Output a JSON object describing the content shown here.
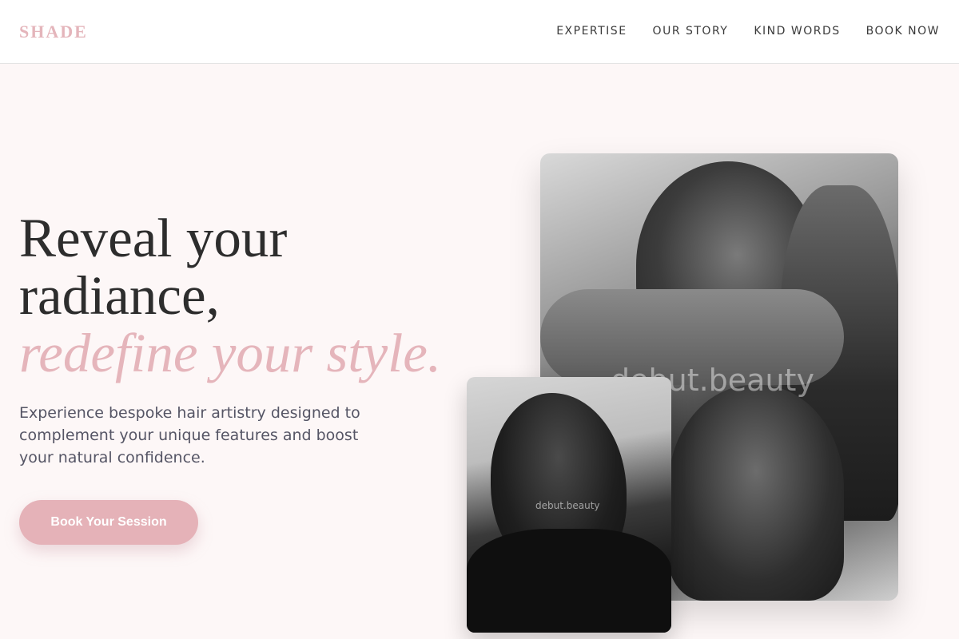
{
  "header": {
    "logo": "SHADE",
    "nav": [
      "EXPERTISE",
      "OUR STORY",
      "KIND WORDS",
      "BOOK NOW"
    ]
  },
  "hero": {
    "title_line1": "Reveal your",
    "title_line2": "radiance,",
    "title_accent": "redefine your style.",
    "description": "Experience bespoke hair artistry designed to complement your unique features and boost your natural confidence.",
    "cta_label": "Book Your Session"
  },
  "images": {
    "main_watermark": "debut.beauty",
    "small_watermark": "debut.beauty"
  },
  "colors": {
    "accent": "#e5b5bb",
    "background": "#fdf7f7",
    "text": "#2d2d2d"
  }
}
